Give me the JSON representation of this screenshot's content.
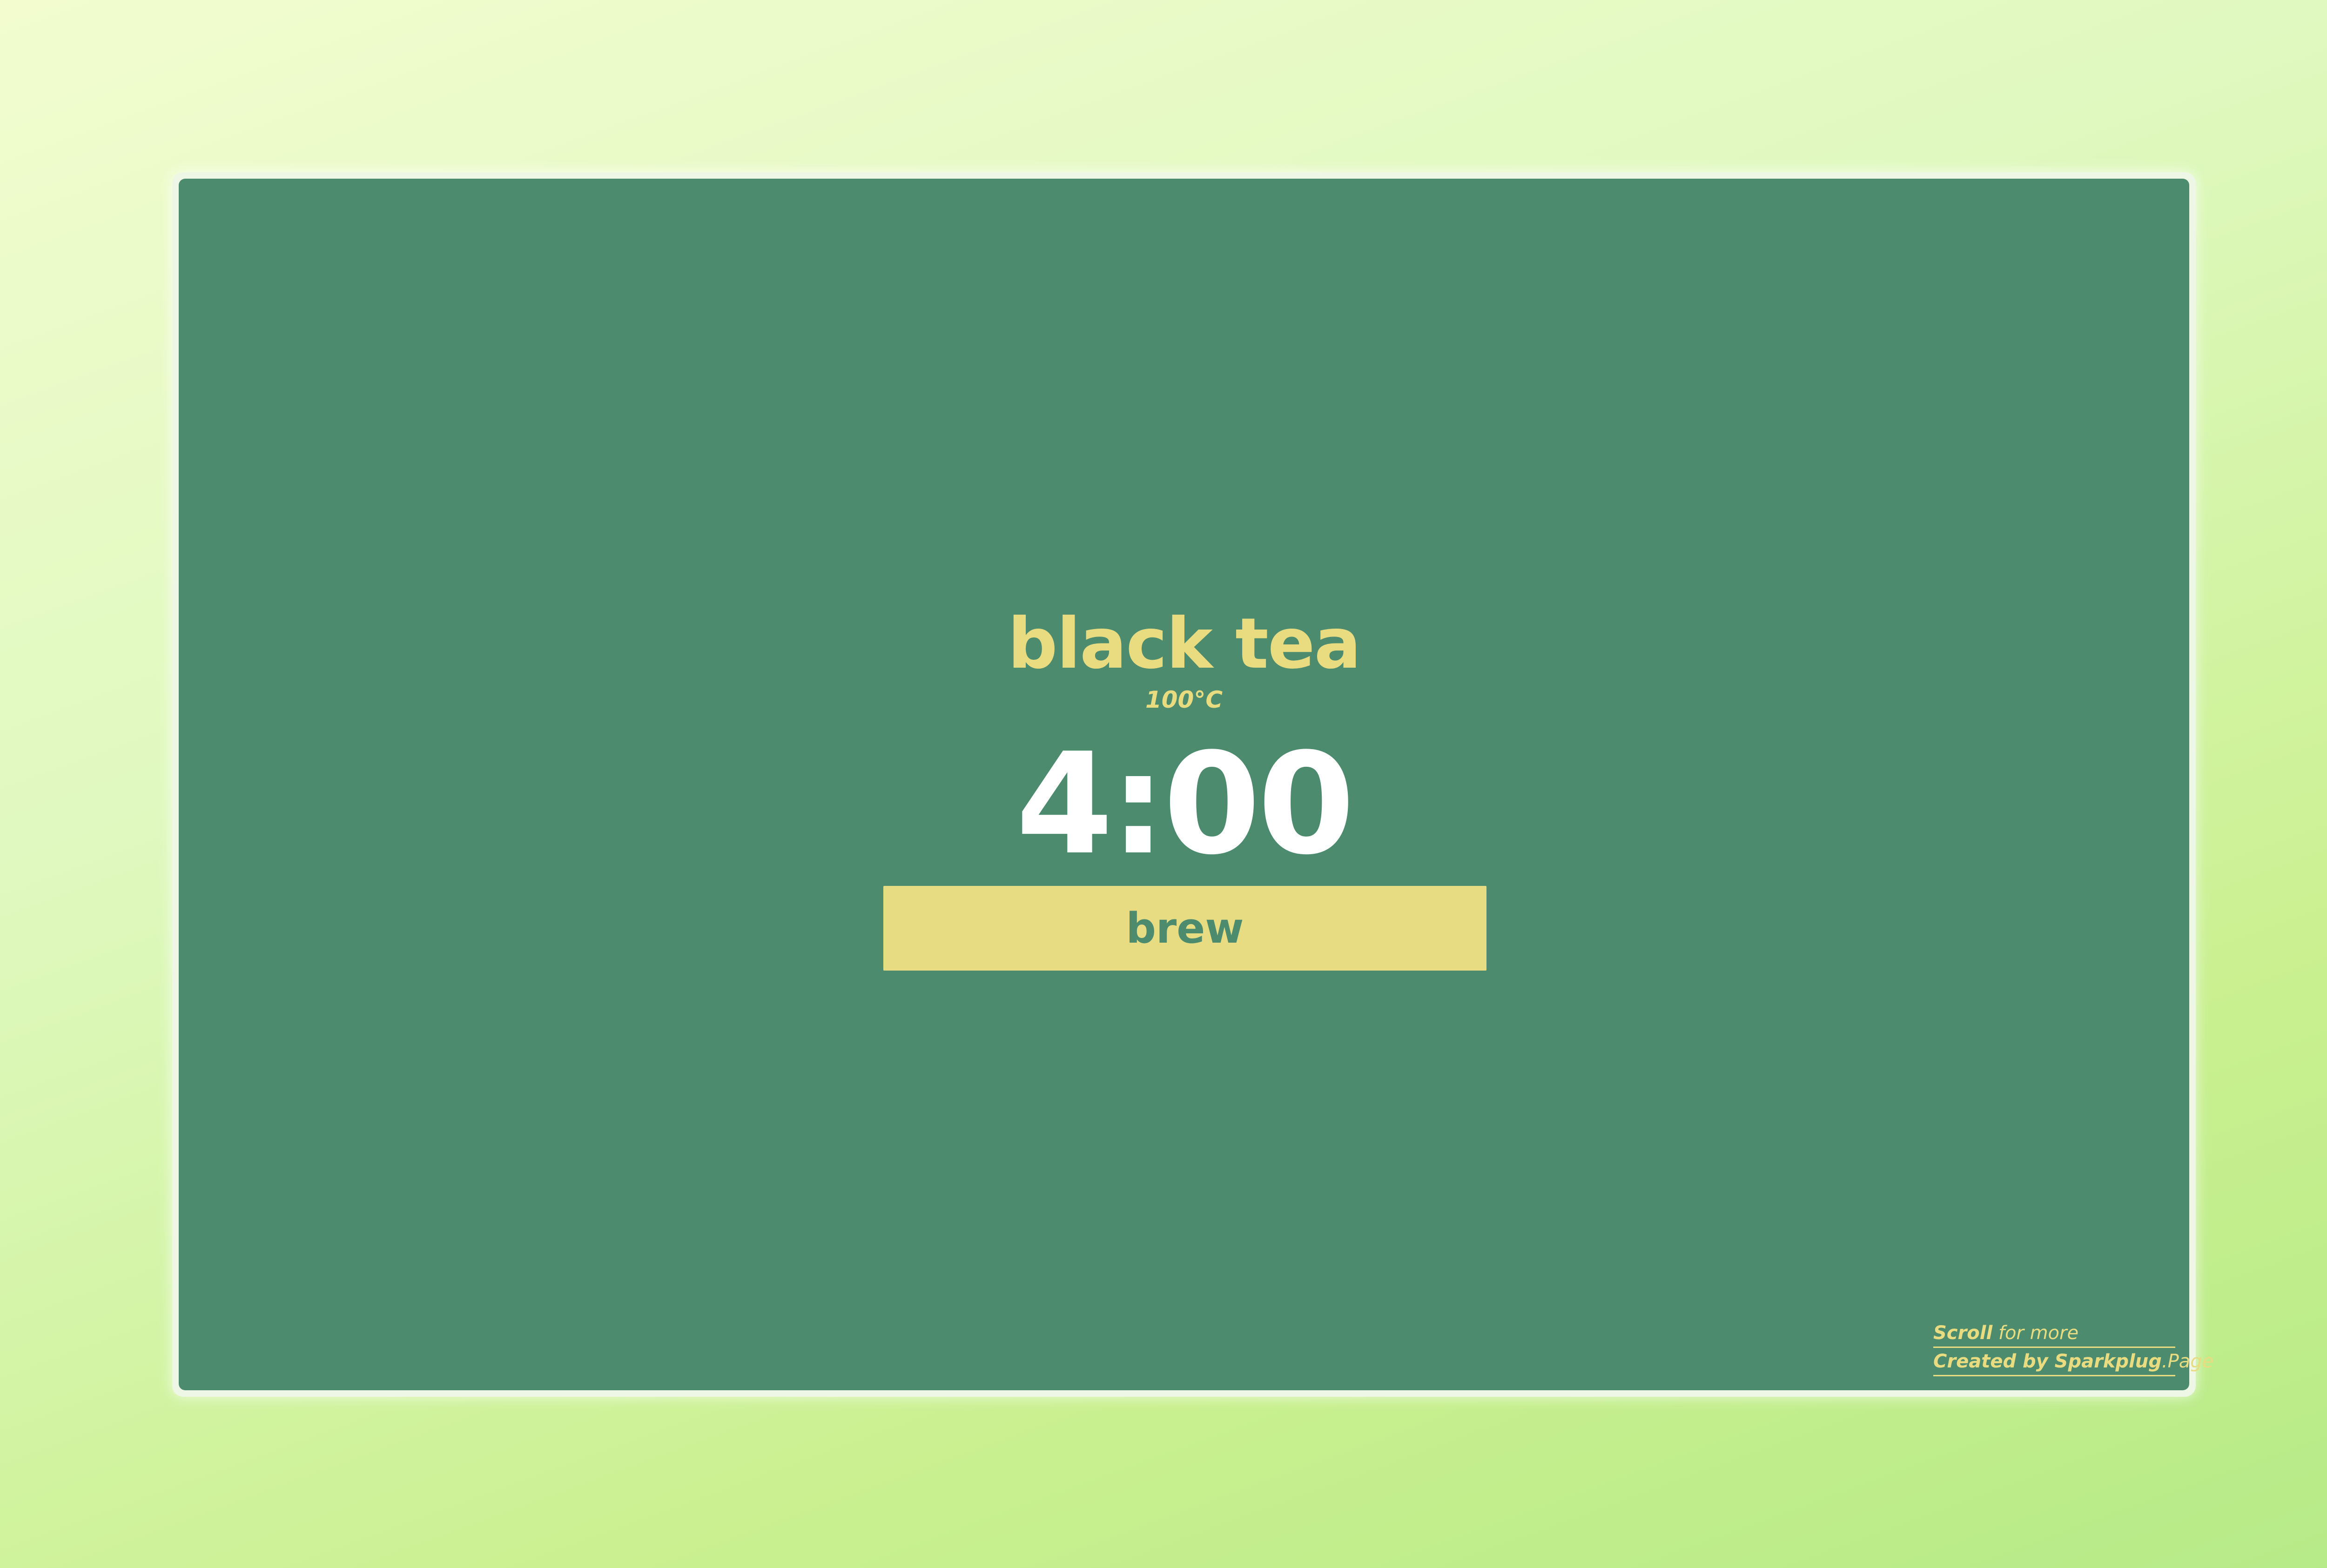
{
  "timer": {
    "tea_name": "black tea",
    "temperature": "100°C",
    "time": "4:00",
    "brew_label": "brew"
  },
  "footer": {
    "scroll_bold": "Scroll",
    "scroll_rest": " for more",
    "created_bold": "Created by Sparkplug",
    "created_rest": ".Page"
  },
  "colors": {
    "card_background": "#4c8b6e",
    "accent_yellow": "#e8dc82",
    "timer_text": "#ffffff",
    "page_gradient_start": "#f2fccf",
    "page_gradient_end": "#b6ea88"
  }
}
